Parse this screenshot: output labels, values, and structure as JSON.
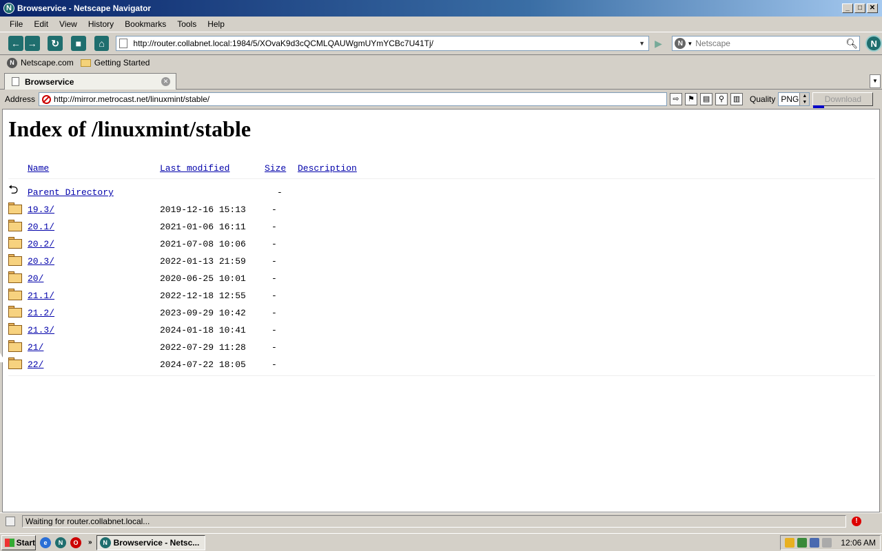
{
  "window": {
    "title": "Browservice - Netscape Navigator",
    "app_icon": "N",
    "buttons": {
      "minimize": "_",
      "maximize": "□",
      "close": "✕"
    }
  },
  "menubar": {
    "items": [
      {
        "label": "File"
      },
      {
        "label": "Edit"
      },
      {
        "label": "View"
      },
      {
        "label": "History"
      },
      {
        "label": "Bookmarks"
      },
      {
        "label": "Tools"
      },
      {
        "label": "Help"
      }
    ]
  },
  "navbar": {
    "url": "http://router.collabnet.local:1984/5/XOvaK9d3cQCMLQAUWgmUYmYCBc7U41Tj/",
    "search_placeholder": "Netscape",
    "logo": "N"
  },
  "bookmarks": {
    "items": [
      {
        "label": "Netscape.com",
        "icon": "netscape-icon"
      },
      {
        "label": "Getting Started",
        "icon": "folder-icon"
      }
    ]
  },
  "tabs": {
    "active": {
      "label": "Browservice"
    }
  },
  "addressbar": {
    "label": "Address",
    "url": "http://mirror.metrocast.net/linuxmint/stable/",
    "quality_label": "Quality",
    "quality_value": "PNG",
    "download_label": "Download"
  },
  "page": {
    "title": "Index of /linuxmint/stable",
    "columns": {
      "name": "Name",
      "modified": "Last modified",
      "size": "Size",
      "description": "Description"
    },
    "parent": {
      "name": "Parent Directory",
      "size": "-"
    },
    "rows": [
      {
        "name": "19.3/",
        "modified": "2019-12-16 15:13",
        "size": "-"
      },
      {
        "name": "20.1/",
        "modified": "2021-01-06 16:11",
        "size": "-"
      },
      {
        "name": "20.2/",
        "modified": "2021-07-08 10:06",
        "size": "-"
      },
      {
        "name": "20.3/",
        "modified": "2022-01-13 21:59",
        "size": "-"
      },
      {
        "name": "20/",
        "modified": "2020-06-25 10:01",
        "size": "-"
      },
      {
        "name": "21.1/",
        "modified": "2022-12-18 12:55",
        "size": "-"
      },
      {
        "name": "21.2/",
        "modified": "2023-09-29 10:42",
        "size": "-"
      },
      {
        "name": "21.3/",
        "modified": "2024-01-18 10:41",
        "size": "-"
      },
      {
        "name": "21/",
        "modified": "2022-07-29 11:28",
        "size": "-"
      },
      {
        "name": "22/",
        "modified": "2024-07-22 18:05",
        "size": "-"
      }
    ]
  },
  "statusbar": {
    "text": "Waiting for router.collabnet.local..."
  },
  "taskbar": {
    "start_label": "Start",
    "task_label": "Browservice - Netsc...",
    "clock": "12:06 AM"
  },
  "colors": {
    "titlebar_start": "#0a246a",
    "link": "#0000aa",
    "chrome": "#d4d0c8"
  }
}
